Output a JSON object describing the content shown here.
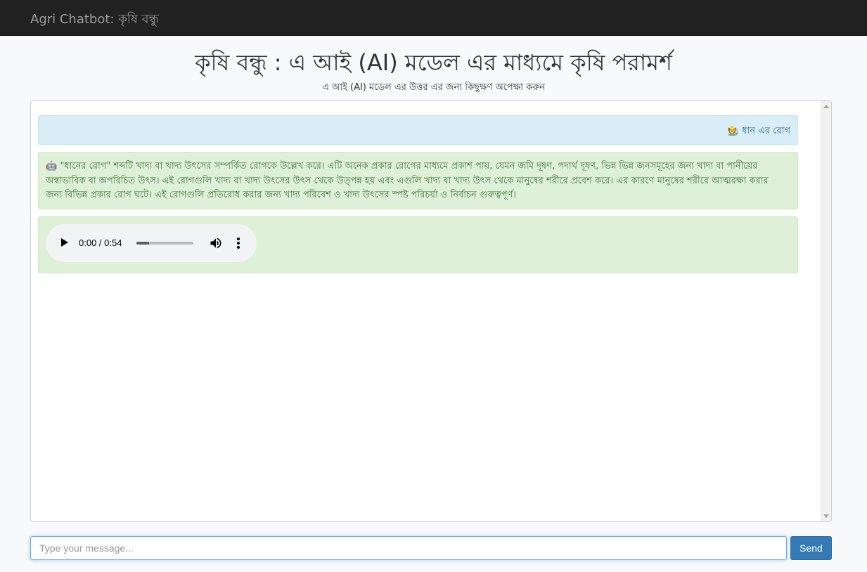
{
  "navbar": {
    "brand": "Agri Chatbot: কৃষি বন্ধু"
  },
  "header": {
    "title": "কৃষি বন্ধু : এ আই (AI) মডেল এর মাধ্যমে কৃষি পরামর্শ",
    "subtitle": "এ আই (AI) মডেল এর উত্তর এর জন্য কিছুক্ষণ অপেক্ষা করুন"
  },
  "chat": {
    "messages": [
      {
        "role": "user",
        "icon": "farmer-emoji",
        "text": "🧑‍🌾 ধান এর রোগ"
      },
      {
        "role": "bot",
        "icon": "robot-emoji",
        "text": "🤖 \"ধানের রোগ\" শব্দটি খাদ্য বা খাদ্য উৎসের সম্পর্কিত রোগকে উল্লেখ করে। এটি অনেক প্রকার রোগের মাধ্যমে প্রকাশ পায়, যেমন জমি দূষণ, পদার্থ দূষণ, ভিন্ন ভিন্ন জনসমূহের জন্য খাদ্য বা পানীয়ের অস্বাভাবিক বা অপরিচিত উৎস। এই রোগগুলি খাদ্য বা খাদ্য উৎসের উৎস থেকে উত্পন্ন হয় এবং এগুলি খাদ্য বা খাদ্য উৎস থেকে মানুষের শরীরে প্রবেশ করে। এর কারণে মানুষের শরীরে আত্মরক্ষা করার জন্য বিভিন্ন প্রকার রোগ ঘটে। এই রোগগুলি প্রতিরোধ করার জন্য খাদ্য পরিবেশ ও খাদ্য উৎসের স্পষ্ট পরিচর্যা ও নির্বাচন গুরুত্বপূর্ণ।"
      }
    ],
    "audio": {
      "time": "0:00 / 0:54",
      "progress": 0.22
    }
  },
  "input": {
    "placeholder": "Type your message...",
    "value": ""
  },
  "send_button": {
    "label": "Send"
  },
  "colors": {
    "navbar": "#212121",
    "user_bubble": "#d9edf7",
    "bot_bubble": "#dff0d8",
    "send_button": "#337ab7"
  }
}
